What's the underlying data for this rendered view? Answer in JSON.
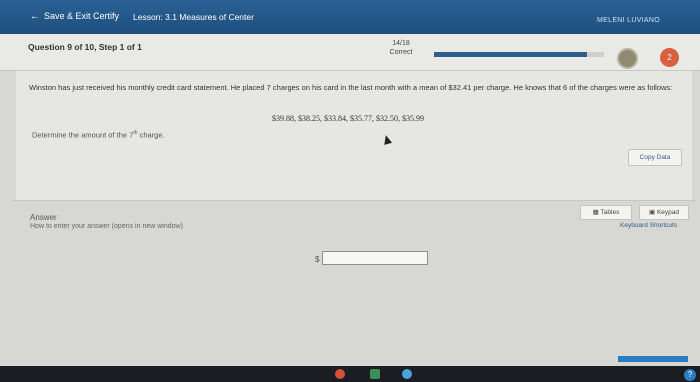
{
  "topbar": {
    "exit_label": "Save & Exit Certify",
    "lesson": "Lesson: 3.1 Measures of Center",
    "user": "MELENI LUVIANO"
  },
  "question": {
    "title": "Question 9 of 10, Step 1 of 1",
    "score": "14/18",
    "status": "Correct",
    "progress": 0.9,
    "badge_number": "2"
  },
  "problem": {
    "text": "Winston has just received his monthly credit card statement. He placed 7 charges on his card in the last month with a mean of $32.41 per charge. He knows that 6 of the charges were as follows:",
    "values": "$39.88, $38.25, $33.84, $35.77, $32.50, $35.99",
    "prompt_text": "Determine the amount of the ",
    "prompt_sup": "th",
    "prompt_tail": " charge.",
    "prompt_num": "7"
  },
  "buttons": {
    "copy_data": "Copy Data",
    "tables": "Tables",
    "keypad": "Keypad",
    "shortcuts": "Keyboard Shortcuts"
  },
  "answer": {
    "label": "Answer",
    "howto": "How to enter your answer (opens in new window)",
    "currency": "$",
    "value": ""
  },
  "colors": {
    "topbar": "#1f4f80",
    "progress": "#2f5f8f",
    "badge": "#d9603f"
  }
}
